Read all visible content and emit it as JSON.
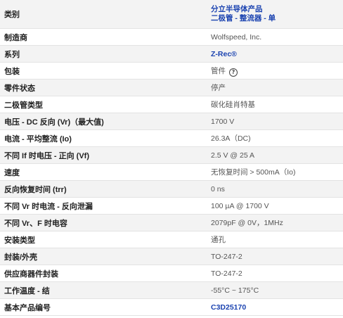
{
  "rows": [
    {
      "attr": "类别",
      "value": "分立半导体产品",
      "value2": "二极管 - 整流器 - 单"
    },
    {
      "attr": "制造商",
      "value": "Wolfspeed, Inc."
    },
    {
      "attr": "系列",
      "value": "Z-Rec®"
    },
    {
      "attr": "包装",
      "value": "管件",
      "icon": "help-circle-icon"
    },
    {
      "attr": "零件状态",
      "value": "停产"
    },
    {
      "attr": "二极管类型",
      "value": "碳化硅肖特基"
    },
    {
      "attr": "电压 - DC 反向 (Vr)（最大值)",
      "value": "1700 V"
    },
    {
      "attr": "电流 - 平均整流 (Io)",
      "value": "26.3A（DC)"
    },
    {
      "attr": "不同 If 时电压 - 正向 (Vf)",
      "value": "2.5 V @ 25 A"
    },
    {
      "attr": "速度",
      "value": "无恢复时间 > 500mA（Io)"
    },
    {
      "attr": "反向恢复时间 (trr)",
      "value": "0 ns"
    },
    {
      "attr": "不同 Vr 时电流 - 反向泄漏",
      "value": "100 µA @ 1700 V"
    },
    {
      "attr": "不同 Vr、F 时电容",
      "value": "2079pF @ 0V，1MHz"
    },
    {
      "attr": "安装类型",
      "value": "通孔"
    },
    {
      "attr": "封装/外壳",
      "value": "TO-247-2"
    },
    {
      "attr": "供应商器件封装",
      "value": "TO-247-2"
    },
    {
      "attr": "工作温度 - 结",
      "value": "-55°C ~ 175°C"
    },
    {
      "attr": "基本产品编号",
      "value": "C3D25170"
    }
  ],
  "colors": {
    "link": "#1a42b0",
    "row_shade": "#f3f3f3",
    "border": "#e3e3e3"
  }
}
